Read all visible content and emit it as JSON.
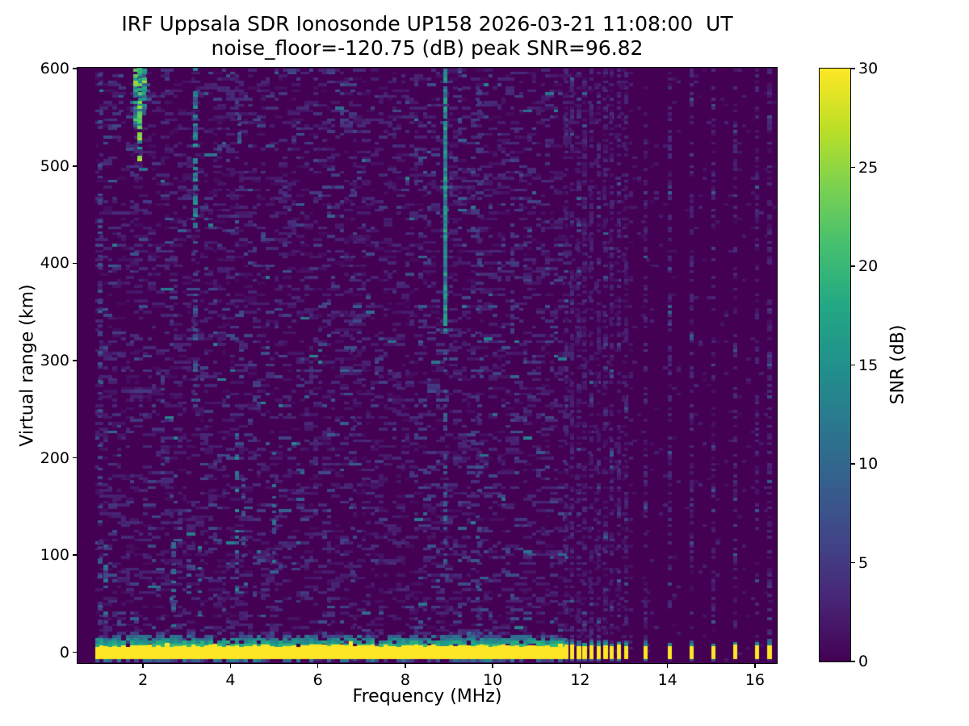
{
  "chart_data": {
    "type": "heatmap",
    "title_line1": "IRF Uppsala SDR Ionosonde UP158 2026-03-21 11:08:00  UT",
    "title_line2": "noise_floor=-120.75 (dB) peak SNR=96.82",
    "station": "UP158",
    "timestamp_ut": "2026-03-21 11:08:00",
    "noise_floor_db": -120.75,
    "peak_snr_db": 96.82,
    "xlabel": "Frequency (MHz)",
    "ylabel": "Virtual range (km)",
    "colorbar_label": "SNR (dB)",
    "xlim": [
      0.5,
      16.5
    ],
    "ylim": [
      -11,
      601
    ],
    "xticks": [
      2,
      4,
      6,
      8,
      10,
      12,
      14,
      16
    ],
    "yticks": [
      0,
      100,
      200,
      300,
      400,
      500,
      600
    ],
    "colorbar_range": [
      0,
      30
    ],
    "colorbar_ticks": [
      0,
      5,
      10,
      15,
      20,
      25,
      30
    ],
    "grid": false,
    "legend": "none",
    "colormap": "viridis",
    "colormap_stops": [
      [
        0.0,
        "#440154"
      ],
      [
        0.1,
        "#482475"
      ],
      [
        0.2,
        "#414487"
      ],
      [
        0.3,
        "#355f8d"
      ],
      [
        0.4,
        "#2a788e"
      ],
      [
        0.5,
        "#21918c"
      ],
      [
        0.6,
        "#22a884"
      ],
      [
        0.7,
        "#44bf70"
      ],
      [
        0.8,
        "#7ad151"
      ],
      [
        0.9,
        "#bddf26"
      ],
      [
        1.0,
        "#fde725"
      ]
    ],
    "colors": {
      "figure_background": "#ffffff",
      "map_min": "#440154",
      "map_max": "#fde725",
      "text": "#000000"
    },
    "random_seed": 20260321,
    "texture": {
      "freq_bin_mhz": 0.1,
      "range_bin_km": 3,
      "background_speckle_density": 0.2,
      "right_zone_speckle_density": 0.03
    },
    "features": {
      "sounding_band": {
        "f_start": 0.9,
        "f_end": 11.6,
        "range_bottom_km": -6.5,
        "range_top_km": 7,
        "snr_db": 30
      },
      "fringe_above_band": {
        "f_start": 0.9,
        "f_end": 11.6,
        "range_top_km": 26,
        "snr_min": 6,
        "snr_max": 20,
        "taller_zone": [
          7.8,
          10.6
        ]
      },
      "below_band_flecks": {
        "range_km": [
          -10,
          -7
        ],
        "snr_min": 4,
        "snr_max": 14
      },
      "discrete_freqs_dense": [
        11.69,
        11.82,
        11.97,
        12.1,
        12.26,
        12.43,
        12.58,
        12.72,
        12.89,
        13.05
      ],
      "discrete_freqs_sparse": [
        13.5,
        14.05,
        14.55,
        15.05,
        15.55,
        16.05,
        16.33
      ],
      "discrete_column_density": 0.4,
      "top_left_echo_cluster": {
        "f_range": [
          1.78,
          2.08
        ],
        "range_km": [
          555,
          600
        ],
        "snr_min": 10,
        "snr_max": 26
      },
      "rfi_streaks": [
        {
          "f": 1.02,
          "r0": -5,
          "r1": 600,
          "p": 0.3,
          "v0": 2,
          "v1": 9
        },
        {
          "f": 1.15,
          "r0": 30,
          "r1": 115,
          "p": 0.35,
          "v0": 4,
          "v1": 12
        },
        {
          "f": 1.5,
          "r0": 540,
          "r1": 600,
          "p": 0.3,
          "v0": 3,
          "v1": 9
        },
        {
          "f": 1.82,
          "r0": 540,
          "r1": 600,
          "p": 0.75,
          "v0": 8,
          "v1": 22
        },
        {
          "f": 1.92,
          "r0": 505,
          "r1": 600,
          "p": 0.85,
          "v0": 10,
          "v1": 27
        },
        {
          "f": 2.02,
          "r0": 540,
          "r1": 600,
          "p": 0.6,
          "v0": 7,
          "v1": 18
        },
        {
          "f": 2.12,
          "r0": 555,
          "r1": 600,
          "p": 0.35,
          "v0": 4,
          "v1": 12
        },
        {
          "f": 2.45,
          "r0": 200,
          "r1": 300,
          "p": 0.2,
          "v0": 3,
          "v1": 8
        },
        {
          "f": 2.7,
          "r0": 20,
          "r1": 115,
          "p": 0.3,
          "v0": 4,
          "v1": 12
        },
        {
          "f": 3.2,
          "r0": 430,
          "r1": 600,
          "p": 0.55,
          "v0": 5,
          "v1": 16
        },
        {
          "f": 3.2,
          "r0": 240,
          "r1": 430,
          "p": 0.3,
          "v0": 3,
          "v1": 10
        },
        {
          "f": 3.3,
          "r0": 25,
          "r1": 120,
          "p": 0.3,
          "v0": 4,
          "v1": 13
        },
        {
          "f": 3.05,
          "r0": 60,
          "r1": 110,
          "p": 0.25,
          "v0": 4,
          "v1": 10
        },
        {
          "f": 4.15,
          "r0": 60,
          "r1": 240,
          "p": 0.3,
          "v0": 4,
          "v1": 14
        },
        {
          "f": 4.2,
          "r0": 520,
          "r1": 565,
          "p": 0.35,
          "v0": 5,
          "v1": 13
        },
        {
          "f": 4.3,
          "r0": 80,
          "r1": 185,
          "p": 0.22,
          "v0": 3,
          "v1": 9
        },
        {
          "f": 5.0,
          "r0": 80,
          "r1": 205,
          "p": 0.28,
          "v0": 4,
          "v1": 12
        },
        {
          "f": 5.05,
          "r0": 555,
          "r1": 600,
          "p": 0.3,
          "v0": 4,
          "v1": 11
        },
        {
          "f": 6.8,
          "r0": 0,
          "r1": 600,
          "p": 0.07,
          "v0": 2,
          "v1": 6
        },
        {
          "f": 8.92,
          "r0": 330,
          "r1": 600,
          "p": 0.95,
          "v0": 9,
          "v1": 19
        },
        {
          "f": 8.92,
          "r0": 90,
          "r1": 330,
          "p": 0.4,
          "v0": 4,
          "v1": 11
        },
        {
          "f": 9.25,
          "r0": 520,
          "r1": 600,
          "p": 0.3,
          "v0": 3,
          "v1": 8
        },
        {
          "f": 9.7,
          "r0": 0,
          "r1": 600,
          "p": 0.22,
          "v0": 2,
          "v1": 7
        },
        {
          "f": 10.45,
          "r0": 300,
          "r1": 600,
          "p": 0.12,
          "v0": 2,
          "v1": 6
        }
      ]
    }
  }
}
